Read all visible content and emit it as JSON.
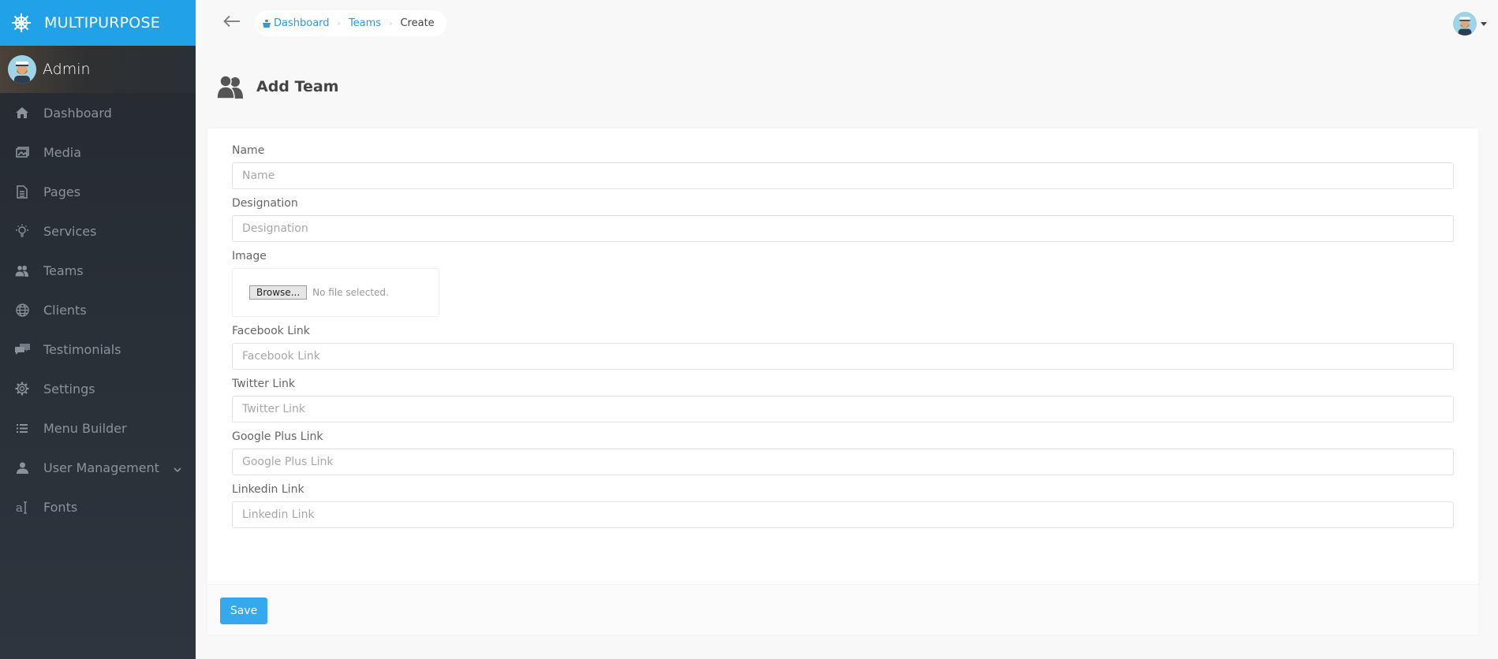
{
  "brand": {
    "title": "MULTIPURPOSE",
    "icon": "ship-wheel-icon",
    "color": "#20a1e8"
  },
  "user_panel": {
    "name": "Admin"
  },
  "sidebar": {
    "items": [
      {
        "label": "Dashboard",
        "icon": "home-icon"
      },
      {
        "label": "Media",
        "icon": "images-icon"
      },
      {
        "label": "Pages",
        "icon": "file-text-icon"
      },
      {
        "label": "Services",
        "icon": "lightbulb-icon"
      },
      {
        "label": "Teams",
        "icon": "users-icon"
      },
      {
        "label": "Clients",
        "icon": "globe-icon"
      },
      {
        "label": "Testimonials",
        "icon": "comments-icon"
      },
      {
        "label": "Settings",
        "icon": "gear-icon"
      },
      {
        "label": "Menu Builder",
        "icon": "list-icon"
      },
      {
        "label": "User Management",
        "icon": "user-icon",
        "has_submenu": true
      },
      {
        "label": "Fonts",
        "icon": "font-icon"
      }
    ]
  },
  "breadcrumb": {
    "items": [
      {
        "label": "Dashboard",
        "link": true,
        "icon": "boat-icon"
      },
      {
        "label": "Teams",
        "link": true
      },
      {
        "label": "Create",
        "link": false
      }
    ]
  },
  "page": {
    "title": "Add Team",
    "icon": "users-icon"
  },
  "form": {
    "name": {
      "label": "Name",
      "placeholder": "Name",
      "value": ""
    },
    "designation": {
      "label": "Designation",
      "placeholder": "Designation",
      "value": ""
    },
    "image": {
      "label": "Image",
      "browse_label": "Browse...",
      "status": "No file selected."
    },
    "facebook": {
      "label": "Facebook Link",
      "placeholder": "Facebook Link",
      "value": ""
    },
    "twitter": {
      "label": "Twitter Link",
      "placeholder": "Twitter Link",
      "value": ""
    },
    "google": {
      "label": "Google Plus Link",
      "placeholder": "Google Plus Link",
      "value": ""
    },
    "linkedin": {
      "label": "Linkedin Link",
      "placeholder": "Linkedin Link",
      "value": ""
    },
    "save_label": "Save"
  },
  "colors": {
    "accent": "#36a9ee",
    "link": "#2e9ad8",
    "sidebar_bg": "#2a3036"
  }
}
